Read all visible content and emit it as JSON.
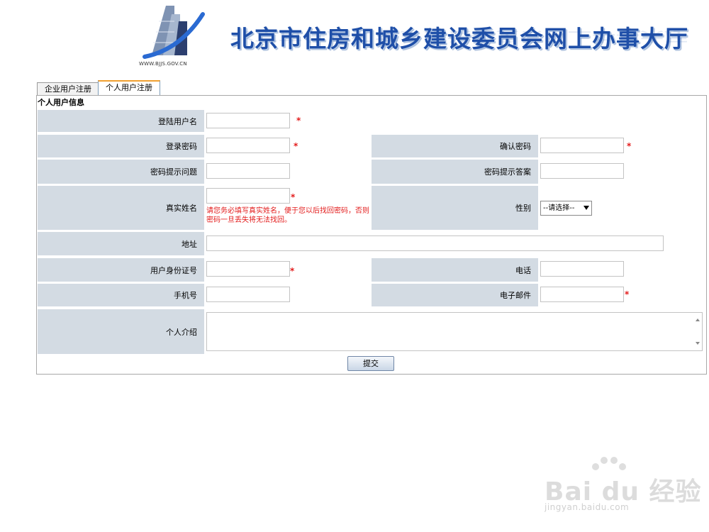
{
  "header": {
    "site_title": "北京市住房和城乡建设委员会网上办事大厅",
    "logo_url_text": "WWW.BJJS.GOV.CN"
  },
  "tabs": [
    {
      "label": "企业用户注册"
    },
    {
      "label": "个人用户注册"
    }
  ],
  "form": {
    "section_title": "个人用户信息",
    "labels": {
      "login_username": "登陆用户名",
      "password": "登录密码",
      "confirm_password": "确认密码",
      "security_question": "密码提示问题",
      "security_answer": "密码提示答案",
      "real_name": "真实姓名",
      "gender": "性别",
      "address": "地址",
      "id_number": "用户身份证号",
      "phone": "电话",
      "mobile": "手机号",
      "email": "电子邮件",
      "intro": "个人介绍"
    },
    "real_name_hint": "请您务必填写真实姓名，便于您以后找回密码，否则密码一旦丢失将无法找回。",
    "gender_select": {
      "selected": "--请选择--"
    },
    "required_mark": "*",
    "submit_label": "提交"
  },
  "watermark": {
    "brand": "Bai du 经验",
    "url": "jingyan.baidu.com"
  },
  "colors": {
    "label_bg": "#d3dbe3",
    "title_blue": "#1f4fa8",
    "required_red": "#e31b1b",
    "active_tab_accent": "#f0a030"
  }
}
